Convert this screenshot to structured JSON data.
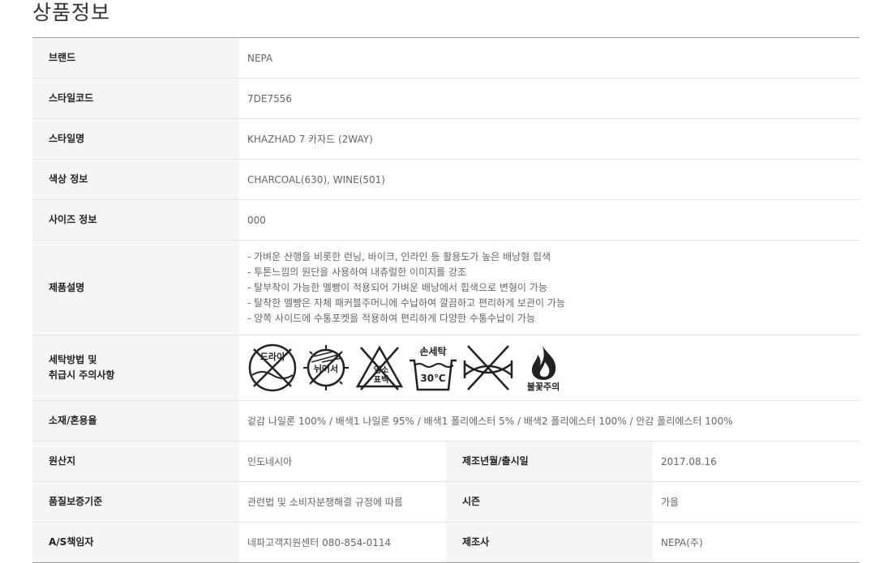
{
  "page_title": "상품정보",
  "rows": {
    "brand": {
      "label": "브랜드",
      "value": "NEPA"
    },
    "style_code": {
      "label": "스타일코드",
      "value": "7DE7556"
    },
    "style_name": {
      "label": "스타일명",
      "value": "KHAZHAD 7 카자드 (2WAY)"
    },
    "color": {
      "label": "색상 정보",
      "value": "CHARCOAL(630), WINE(501)"
    },
    "size": {
      "label": "사이즈 정보",
      "value": "000"
    },
    "description": {
      "label": "제품설명",
      "lines": [
        "- 가벼운 산행을 비롯한 런닝, 바이크, 인라인 등 활용도가 높은 배낭형 힙색",
        "- 투톤느낌의 원단을 사용하여 내츄럴한 이미지를 강조",
        "- 탈부착이 가능한 멜빵이 적용되어 가벼운 배낭에서 힙색으로 변형이 가능",
        "- 탈착한 멜빵은 자체 패커블주머니에 수납하여 깔끔하고 편리하게 보관이 가능",
        "- 양쪽 사이드에 수통포켓을 적용하여 편리하게 다양한 수통수납이 가능"
      ]
    },
    "care": {
      "label_line1": "세탁방법 및",
      "label_line2": "취급시 주의사항",
      "icons": [
        {
          "name": "no-dry-clean-icon",
          "text": "드라이"
        },
        {
          "name": "no-tumble-dry-icon",
          "text": "뉘어서"
        },
        {
          "name": "no-bleach-icon",
          "text_line1": "염소",
          "text_line2": "표백"
        },
        {
          "name": "hand-wash-icon",
          "text": "손세탁",
          "temp": "30℃"
        },
        {
          "name": "no-wring-icon"
        },
        {
          "name": "fire-caution-icon",
          "text": "불꽃주의"
        }
      ]
    },
    "material": {
      "label": "소재/혼용율",
      "value": "겉감 나일론 100% / 배색1 나일론 95% / 배색1 폴리에스터 5% / 배색2 폴리에스터 100% / 안감 폴리에스터 100%"
    },
    "origin": {
      "label": "원산지",
      "value": "인도네시아",
      "label2": "제조년월/출시일",
      "value2": "2017.08.16"
    },
    "quality": {
      "label": "품질보증기준",
      "value": "관련법 및 소비자분쟁해결 규정에 따름",
      "label2": "시즌",
      "value2": "가을"
    },
    "as": {
      "label": "A/S책임자",
      "value": "네파고객지원센터 080-854-0114",
      "label2": "제조사",
      "value2": "NEPA(주)"
    }
  }
}
